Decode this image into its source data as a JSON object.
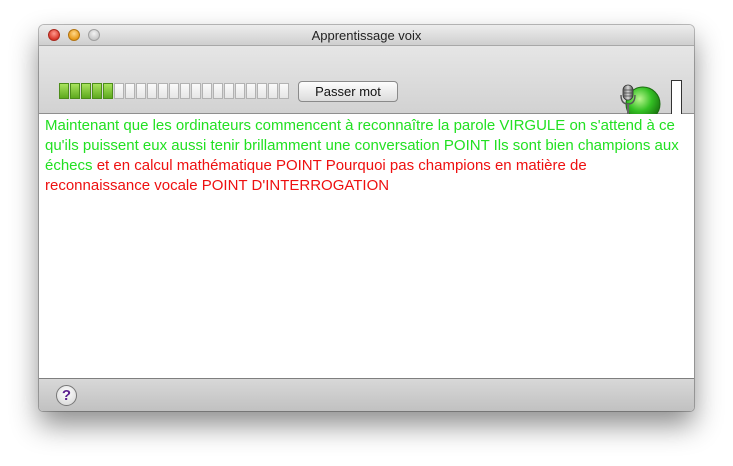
{
  "window": {
    "title": "Apprentissage voix"
  },
  "toolbar": {
    "progress": {
      "segments_total": 21,
      "segments_filled": 5
    },
    "skip_button_label": "Passer mot",
    "mic_status_color": "#34c024",
    "level_meter_color": "#cc1a1a",
    "level_meter_fraction": 0.04
  },
  "content": {
    "recognized_text": "Maintenant que les ordinateurs commencent à reconnaître la parole VIRGULE on s'attend à ce qu'ils puissent eux aussi tenir brillamment une conversation POINT Ils sont bien champions aux échecs",
    "pending_text": " et en calcul mathématique POINT Pourquoi pas champions en matière de reconnaissance vocale POINT D'INTERROGATION",
    "recognized_color": "#22e022",
    "pending_color": "#ee1010"
  },
  "footer": {
    "help_label": "?"
  },
  "icons": {
    "close": "close-button",
    "minimize": "minimize-button",
    "zoom": "zoom-button",
    "microphone": "microphone-icon",
    "help": "help-icon"
  }
}
